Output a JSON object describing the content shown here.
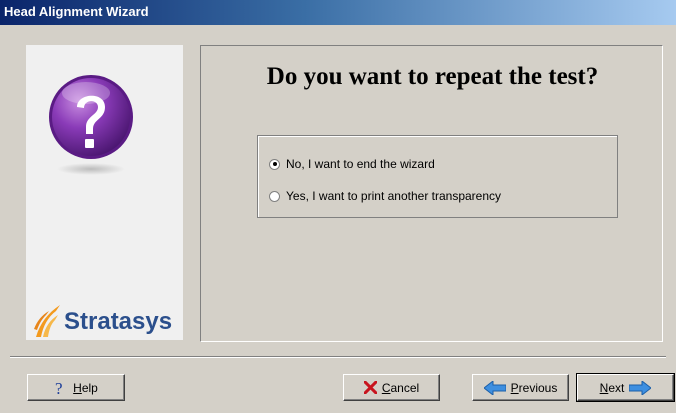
{
  "window": {
    "title": "Head Alignment Wizard"
  },
  "sidebar": {
    "logo_text": "Stratasys",
    "icon": "question-mark-icon"
  },
  "main": {
    "heading": "Do you want to repeat the test?",
    "options": [
      {
        "label": "No, I want to end the wizard",
        "checked": true
      },
      {
        "label": "Yes, I want to print another transparency",
        "checked": false
      }
    ]
  },
  "buttons": {
    "help": "Help",
    "cancel": "Cancel",
    "previous": "Previous",
    "next": "Next"
  },
  "colors": {
    "title_gradient_start": "#0a246a",
    "window_bg": "#d4d0c8",
    "question_purple": "#7a2fa0",
    "logo_orange": "#f39a1e",
    "logo_blue": "#2b4f8c"
  }
}
